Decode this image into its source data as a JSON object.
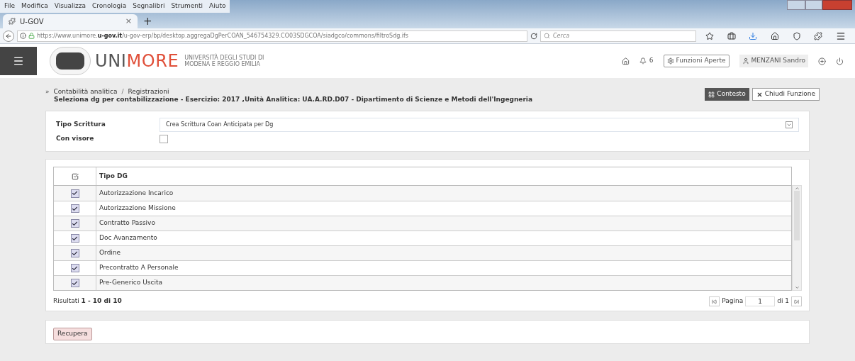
{
  "menu_bar": [
    "File",
    "Modifica",
    "Visualizza",
    "Cronologia",
    "Segnalibri",
    "Strumenti",
    "Aiuto"
  ],
  "tab": {
    "title": "U-GOV",
    "close": "×",
    "new_tab": "+"
  },
  "address_bar": {
    "url_host": "https://www.unimore.",
    "url_domain": "u-gov.it",
    "url_path": "/u-gov-erp/bp/desktop.aggregaDgPerCOAN_546754329.CO03SDGCOA/siadgco/commons/filtroSdg.ifs",
    "search_placeholder": "Cerca"
  },
  "app_header": {
    "logo_uni": "UNI",
    "logo_more": "MORE",
    "logo_subtitle_1": "UNIVERSITÀ DEGLI STUDI DI",
    "logo_subtitle_2": "MODENA E REGGIO EMILIA",
    "notifications": "6",
    "open_functions": "Funzioni Aperte",
    "user": "MENZANI Sandro"
  },
  "breadcrumb": {
    "marker": "»",
    "separator": "/",
    "items": [
      "Contabilità analitica",
      "Registrazioni"
    ],
    "current": "Seleziona dg per contabilizzazione - Esercizio: 2017 ,Unità Analitica: UA.A.RD.D07 - Dipartimento di Scienze e Metodi dell'Ingegneria"
  },
  "actions": [
    "Contesto",
    "Chiudi Funzione"
  ],
  "form": {
    "tipo_label": "Tipo Scrittura",
    "tipo_value": "Crea Scrittura Coan Anticipata per Dg",
    "visore_label": "Con visore",
    "visore_checked": false
  },
  "table": {
    "column": "Tipo DG",
    "rows": [
      {
        "label": "Autorizzazione Incarico",
        "checked": true
      },
      {
        "label": "Autorizzazione Missione",
        "checked": true
      },
      {
        "label": "Contratto Passivo",
        "checked": true
      },
      {
        "label": "Doc Avanzamento",
        "checked": true
      },
      {
        "label": "Ordine",
        "checked": true
      },
      {
        "label": "Precontratto A Personale",
        "checked": true
      },
      {
        "label": "Pre-Generico Uscita",
        "checked": true
      }
    ]
  },
  "results": "Risultati **1 - 10 di 10**",
  "pager": {
    "label": "Pagina",
    "page": "1",
    "of": "di 1"
  },
  "recupera": "Recupera"
}
